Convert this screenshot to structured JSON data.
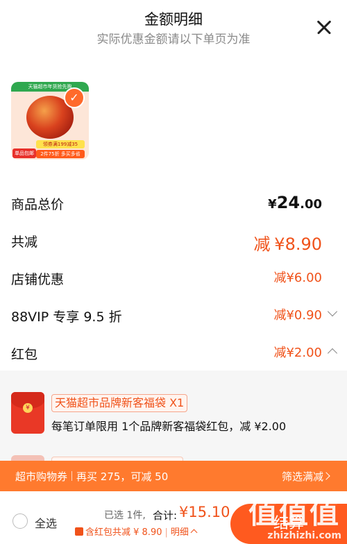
{
  "header": {
    "title": "金额明细",
    "subtitle": "实际优惠金额请以下单页为准"
  },
  "product": {
    "thumb_bar": "天猫超市年货抢先购",
    "tag1": "领券满199减35",
    "tag2": "2件75折 多买多省",
    "badge": "单品包邮"
  },
  "rows": {
    "total": {
      "label": "商品总价",
      "currency": "¥",
      "int": "24",
      "dec": ".00"
    },
    "reduced": {
      "label": "共减",
      "prefix": "减",
      "currency": "¥",
      "int": "8.90"
    },
    "store": {
      "label": "店铺优惠",
      "value": "减¥6.00"
    },
    "vip": {
      "label": "88VIP 专享 9.5 折",
      "value": "减¥0.90"
    },
    "redpacket": {
      "label": "红包",
      "value": "减¥2.00"
    }
  },
  "packet": {
    "coin": "¥",
    "tag": "天猫超市品牌新客福袋 X1",
    "desc": "每笔订单限用 1个品牌新客福袋红包，减 ¥2.00"
  },
  "promo": {
    "left_a": "超市购物券",
    "left_b": "再买 275，可减 50",
    "right": "筛选满减"
  },
  "bottom": {
    "select_all": "全选",
    "selected": "已选 1件,",
    "total_label": "合计:",
    "total_value": "¥15.10",
    "discount": "含红包共减 ¥ 8.90",
    "detail": "明细",
    "checkout": "结算",
    "watermark": "zhizhizhi.com",
    "watermark_big": "值值值"
  },
  "colors": {
    "accent": "#f0521a",
    "promo": "#ff7a2e",
    "checkout": "#ff5a1f"
  }
}
